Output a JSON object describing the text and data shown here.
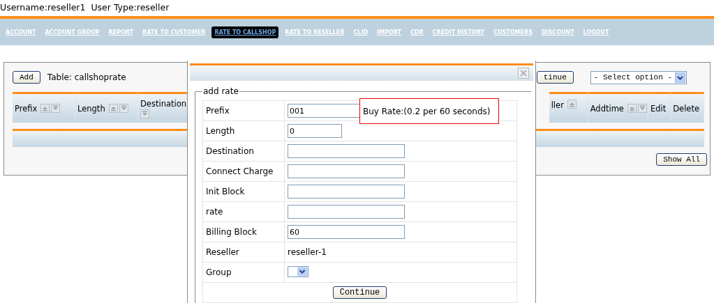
{
  "header": {
    "texts": [
      "Username:reseller1",
      "User Type:reseller"
    ]
  },
  "nav": [
    {
      "label": "ACCOUNT",
      "selected": false
    },
    {
      "label": "ACCOUNT GROUP",
      "selected": false
    },
    {
      "label": "REPORT",
      "selected": false
    },
    {
      "label": "RATE TO CUSTOMER",
      "selected": false
    },
    {
      "label": "RATE TO CALLSHOP",
      "selected": true
    },
    {
      "label": "RATE TO RESELLER",
      "selected": false
    },
    {
      "label": "CLID",
      "selected": false
    },
    {
      "label": "IMPORT",
      "selected": false
    },
    {
      "label": "CDR",
      "selected": false
    },
    {
      "label": "CREDIT HISTORY",
      "selected": false
    },
    {
      "label": "CUSTOMERS",
      "selected": false
    },
    {
      "label": "DISCOUNT",
      "selected": false
    },
    {
      "label": "LOGOUT",
      "selected": false
    }
  ],
  "panel": {
    "add_button": "Add",
    "table_title": "Table: callshoprate",
    "continue_button": "tinue",
    "select": {
      "placeholder": "- Select option -"
    },
    "columns_left": [
      {
        "label": "Prefix",
        "sort_up": true,
        "sort_down": true
      },
      {
        "label": "Length",
        "sort_up": true,
        "sort_down": true
      },
      {
        "label": "Destination",
        "sort_up": false,
        "sort_down": true
      }
    ],
    "columns_right": [
      {
        "label": "ller",
        "sort_up": true,
        "sort_down": false
      },
      {
        "label": "Addtime",
        "sort_up": true,
        "sort_down": true
      },
      {
        "label": "Edit",
        "sort_up": false,
        "sort_down": false
      },
      {
        "label": "Delete",
        "sort_up": false,
        "sort_down": false
      }
    ],
    "show_all_button": "Show All"
  },
  "dialog": {
    "legend": "add rate",
    "rows": [
      {
        "label": "Prefix",
        "kind": "medium_input",
        "value": "001"
      },
      {
        "label": "Length",
        "kind": "short_input",
        "value": "0"
      },
      {
        "label": "Destination",
        "kind": "long_input"
      },
      {
        "label": "Connect Charge",
        "kind": "long_input"
      },
      {
        "label": "Init Block",
        "kind": "long_input"
      },
      {
        "label": "rate",
        "kind": "long_input"
      },
      {
        "label": "Billing Block",
        "kind": "long_input",
        "value": "60"
      },
      {
        "label": "Reseller",
        "kind": "text",
        "value": "reseller-1"
      },
      {
        "label": "Group",
        "kind": "select"
      }
    ],
    "tooltip": "Buy Rate:(0.2 per 60 seconds)",
    "continue_button": "Continue"
  }
}
